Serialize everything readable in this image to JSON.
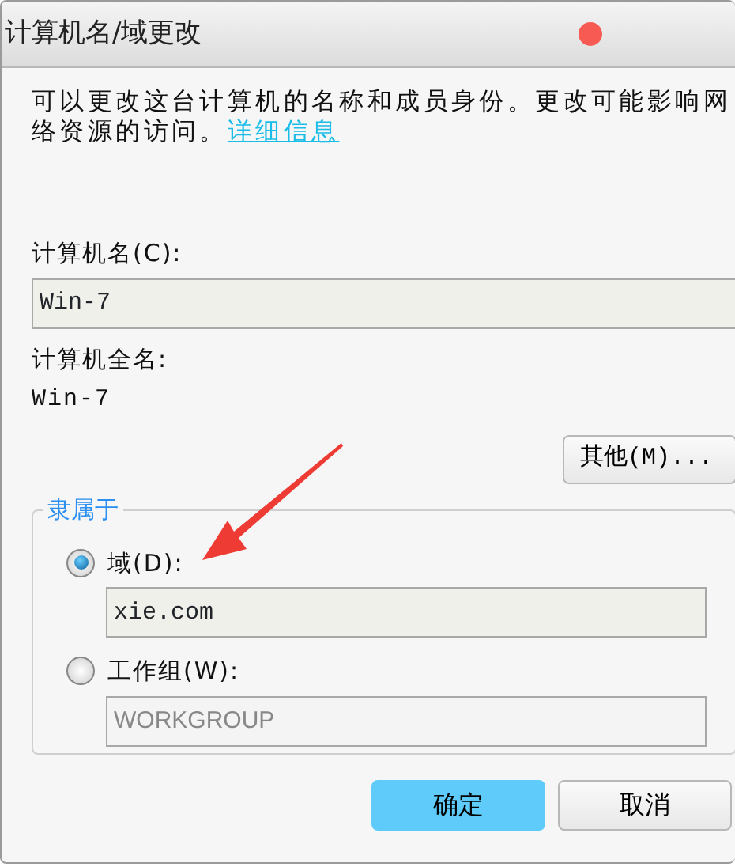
{
  "window": {
    "title": "计算机名/域更改"
  },
  "description": {
    "lines": [
      "可以更改这台计算机的名称和成员身份。更改可能影响网",
      "络资源的访问。"
    ],
    "link": "详细信息"
  },
  "computer_name": {
    "label": "计算机名(C):",
    "value": "Win-7"
  },
  "full_name": {
    "label": "计算机全名:",
    "value": "Win-7"
  },
  "other_button": "其他(M)...",
  "member_of": {
    "legend": "隶属于",
    "options": [
      {
        "label": "域(D):",
        "selected": true,
        "value": "xie.com",
        "disabled": false
      },
      {
        "label": "工作组(W):",
        "selected": false,
        "value": "WORKGROUP",
        "disabled": true
      }
    ]
  },
  "buttons": [
    {
      "label": "确定",
      "primary": true
    },
    {
      "label": "取消",
      "primary": false
    }
  ]
}
